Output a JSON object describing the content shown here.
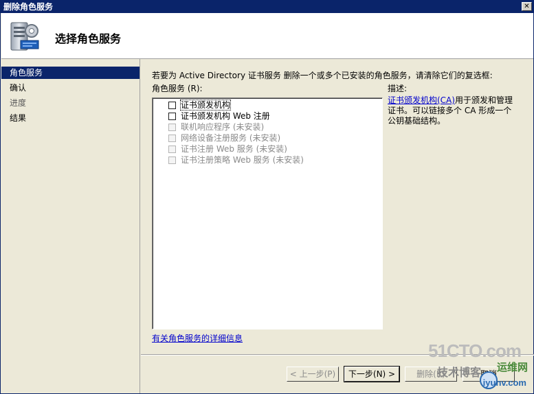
{
  "window": {
    "title": "删除角色服务",
    "close_glyph": "✕"
  },
  "header": {
    "title": "选择角色服务"
  },
  "nav": {
    "items": [
      {
        "label": "角色服务",
        "active": true
      },
      {
        "label": "确认",
        "active": false
      },
      {
        "label": "进度",
        "active": false
      },
      {
        "label": "结果",
        "active": false
      }
    ]
  },
  "main": {
    "intro": "若要为 Active Directory 证书服务 删除一个或多个已安装的角色服务，请清除它们的复选框:",
    "roles_label": "角色服务 (R):",
    "description_label": "描述:",
    "roles": [
      {
        "label": "证书颁发机构",
        "checked": false,
        "enabled": true,
        "selected": true
      },
      {
        "label": "证书颁发机构 Web 注册",
        "checked": false,
        "enabled": true,
        "selected": false
      },
      {
        "label": "联机响应程序  (未安装)",
        "checked": false,
        "enabled": false,
        "selected": false
      },
      {
        "label": "网络设备注册服务  (未安装)",
        "checked": false,
        "enabled": false,
        "selected": false
      },
      {
        "label": "证书注册 Web 服务  (未安装)",
        "checked": false,
        "enabled": false,
        "selected": false
      },
      {
        "label": "证书注册策略 Web 服务  (未安装)",
        "checked": false,
        "enabled": false,
        "selected": false
      }
    ],
    "description": {
      "link": "证书颁发机构(CA)",
      "text": "用于颁发和管理证书。可以链接多个 CA 形成一个公钥基础结构。"
    },
    "more_info_link": "有关角色服务的详细信息"
  },
  "footer": {
    "back": "< 上一步(P)",
    "next": "下一步(N) >",
    "remove": "删除(R)",
    "cancel": "取消"
  },
  "watermark": {
    "line1": "51CTO.com",
    "line2": "技术博客",
    "line3": "运维网",
    "line4": "iyunv.com"
  },
  "colors": {
    "titlebar": "#0a246a",
    "accent": "#0a246a",
    "link": "#0000cc"
  }
}
